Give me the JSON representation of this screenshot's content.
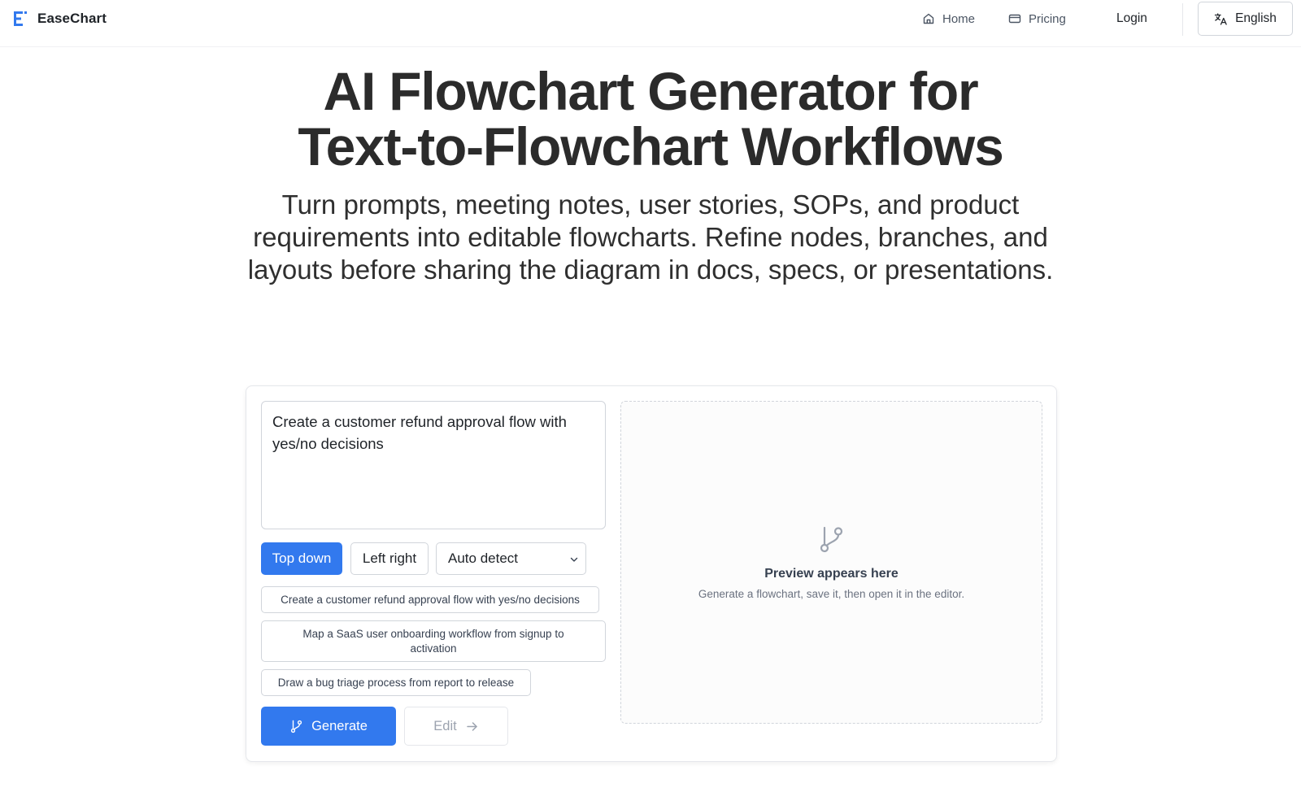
{
  "header": {
    "brand": "EaseChart",
    "nav": {
      "home": "Home",
      "pricing": "Pricing",
      "login": "Login",
      "language": "English"
    }
  },
  "hero": {
    "title_line1": "AI Flowchart Generator for",
    "title_line2": "Text-to-Flowchart Workflows",
    "subtitle": "Turn prompts, meeting notes, user stories, SOPs, and product requirements into editable flowcharts. Refine nodes, branches, and layouts before sharing the diagram in docs, specs, or presentations."
  },
  "generator": {
    "prompt_value": "Create a customer refund approval flow with yes/no decisions",
    "direction": {
      "top_down": "Top down",
      "left_right": "Left right",
      "selected": "Top down"
    },
    "diagram_type": {
      "selected": "Auto detect"
    },
    "examples": [
      "Create a customer refund approval flow with yes/no decisions",
      "Map a SaaS user onboarding workflow from signup to activation",
      "Draw a bug triage process from report to release"
    ],
    "generate_label": "Generate",
    "edit_label": "Edit",
    "preview": {
      "title": "Preview appears here",
      "description": "Generate a flowchart, save it, then open it in the editor."
    }
  },
  "colors": {
    "accent": "#3279ee",
    "text": "#1f2328",
    "muted": "#6b7280",
    "border": "#d1d5db"
  },
  "icons": {
    "brand": "easechart-logo-icon",
    "home": "home-icon",
    "pricing": "card-icon",
    "language": "translate-icon",
    "select": "chevron-down-icon",
    "generate": "git-branch-icon",
    "edit": "arrow-right-icon",
    "preview": "git-branch-icon"
  }
}
